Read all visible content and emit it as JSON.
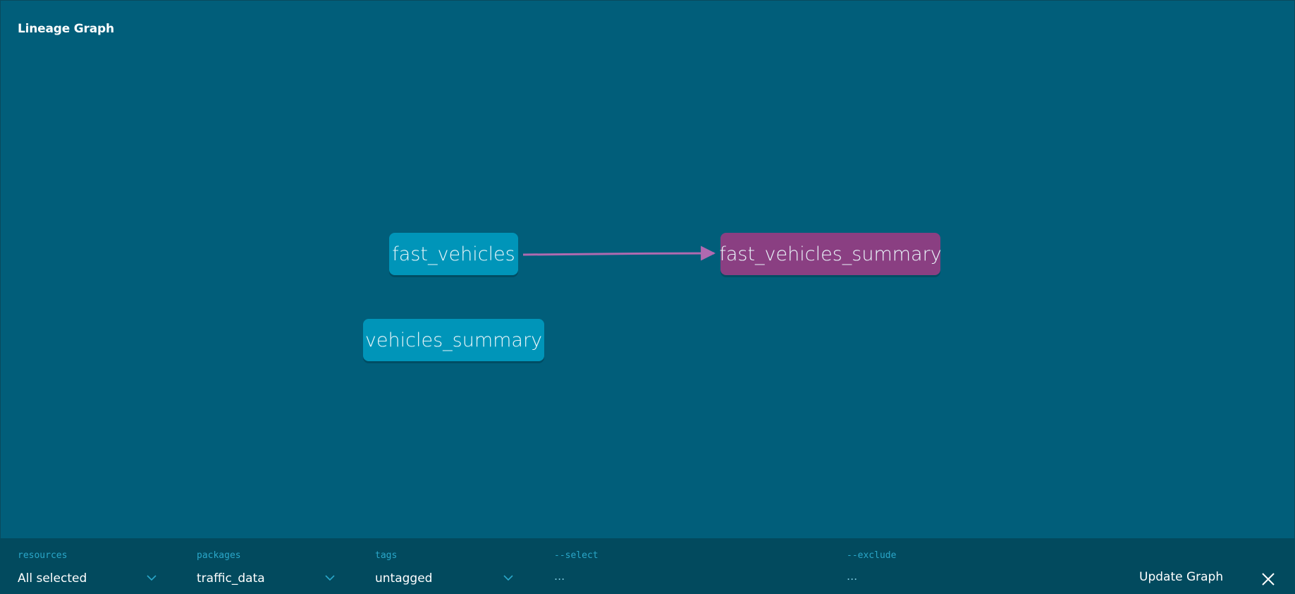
{
  "panel": {
    "title": "Lineage Graph"
  },
  "graph": {
    "nodes": [
      {
        "id": "fast_vehicles",
        "label": "fast_vehicles",
        "kind": "model",
        "color": "#0095b9"
      },
      {
        "id": "vehicles_summary",
        "label": "vehicles_summary",
        "kind": "model",
        "color": "#0095b9"
      },
      {
        "id": "fast_vehicles_summary",
        "label": "fast_vehicles_summary",
        "kind": "selected",
        "color": "#8a3f82"
      }
    ],
    "edges": [
      {
        "from": "fast_vehicles",
        "to": "fast_vehicles_summary",
        "color": "#b06ab0"
      }
    ]
  },
  "toolbar": {
    "resources": {
      "label": "resources",
      "value": "All selected",
      "icon": "chevron-down-icon"
    },
    "packages": {
      "label": "packages",
      "value": "traffic_data",
      "icon": "chevron-down-icon"
    },
    "tags": {
      "label": "tags",
      "value": "untagged",
      "icon": "chevron-down-icon"
    },
    "select": {
      "label": "--select",
      "placeholder": "..."
    },
    "exclude": {
      "label": "--exclude",
      "placeholder": "..."
    },
    "update_label": "Update Graph",
    "close_icon": "close-icon"
  },
  "colors": {
    "background": "#015e7a",
    "toolbar": "#024a5e",
    "label_accent": "#2aa7c9"
  }
}
